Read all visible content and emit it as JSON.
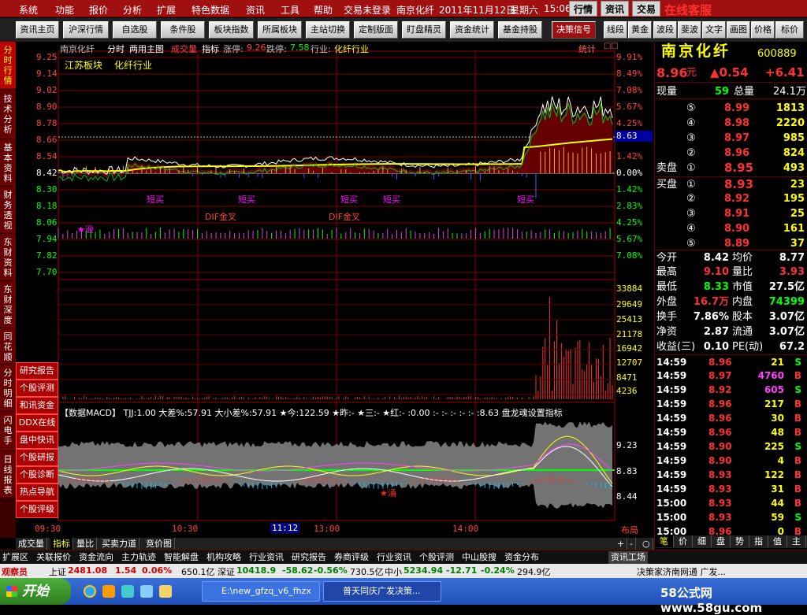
{
  "menu": {
    "items": [
      "系统",
      "功能",
      "报价",
      "分析",
      "扩展",
      "特色数据",
      "资讯",
      "工具",
      "帮助",
      "交易未登录",
      "南京化纤",
      "2011年11月12日",
      "星期六",
      "15:06"
    ],
    "tabs": [
      "行情",
      "资讯",
      "交易"
    ],
    "brand": "在线客服 www.55188.com"
  },
  "toolbar": {
    "buttons": [
      "资讯主页",
      "沪深行情",
      "自选股",
      "条件股",
      "板块指数",
      "所属板块",
      "主站切换",
      "定制版面",
      "盯盘精灵",
      "资金统计",
      "基金持股",
      "决策信号",
      "线段",
      "黄金",
      "波段",
      "斐波",
      "文字",
      "画图",
      "价格",
      "标价"
    ]
  },
  "left_nav": [
    "分时行情",
    "技术分析",
    "基本资料",
    "财务透视",
    "东财资料",
    "东财深度",
    "同花顺",
    "分时明细",
    "闪电手",
    "日线报表"
  ],
  "left_links": [
    "研究报告",
    "个股评测",
    "和讯资金",
    "DDX在线",
    "盘中快讯",
    "个股研报",
    "个股诊断",
    "热点导航",
    "个股评级"
  ],
  "chart": {
    "header": {
      "name": "南京化纤",
      "mode": "分时",
      "main": "两用主图",
      "vol": "成交量",
      "ind": "指标",
      "up_label": "涨停:",
      "up_val": "9.26",
      "down_label": "跌停:",
      "down_val": "7.58",
      "ind_label": "行业:",
      "ind_val": "化纤行业",
      "stat": "统计"
    },
    "board": [
      "江苏板块",
      "化纤行业"
    ],
    "price_labels": [
      "9.25",
      "9.14",
      "9.02",
      "8.90",
      "8.78",
      "8.66",
      "8.54",
      "8.42",
      "8.30",
      "8.18",
      "8.06",
      "7.94",
      "7.82",
      "7.70"
    ],
    "pct_labels": [
      "9.91%",
      "8.49%",
      "7.08%",
      "5.67%",
      "4.25%",
      "2.83%",
      "1.42%",
      "0.00%",
      "1.42%",
      "2.83%",
      "4.25%",
      "5.67%",
      "7.08%"
    ],
    "current_tag": "8.63",
    "vol_labels": [
      "33884",
      "29649",
      "25413",
      "21178",
      "16942",
      "12707",
      "8471",
      "4236"
    ],
    "signals": [
      "短买",
      "短买",
      "短买",
      "短买",
      "短买"
    ],
    "dif_cross": [
      "DIF金叉",
      "DIF金叉"
    ],
    "star_label": "★逊",
    "macd_header": "【数据MACD】 TJJ:1.00 大差%:57.91 大小差%:57.91 ★今:122.59 ★昨:- ★三:- ★红:- :0.00 :- :- :- :- :- :8.63 盘龙魂设置指标",
    "macd_labels": [
      "9.23",
      "8.83",
      "8.44"
    ],
    "macd_star": "★涌",
    "time_labels": [
      "09:30",
      "10:30",
      "11:12",
      "13:00",
      "14:00"
    ],
    "layout_btn": "布局"
  },
  "quote": {
    "name": "南京化纤",
    "code": "600889",
    "price": "8.96",
    "price_unit": "元",
    "change": "▲0.54",
    "change_pct": "+6.41",
    "cur_vol_label": "现量",
    "cur_vol": "59",
    "total_vol_label": "总量",
    "total_vol": "24.1万",
    "asks": [
      {
        "lv": "⑤",
        "p": "8.99",
        "v": "1813"
      },
      {
        "lv": "④",
        "p": "8.98",
        "v": "2220"
      },
      {
        "lv": "③",
        "p": "8.97",
        "v": "985"
      },
      {
        "lv": "②",
        "p": "8.96",
        "v": "824"
      },
      {
        "lv": "①",
        "p": "8.95",
        "v": "493",
        "label": "卖盘"
      }
    ],
    "bids": [
      {
        "lv": "①",
        "p": "8.93",
        "v": "23",
        "label": "买盘"
      },
      {
        "lv": "②",
        "p": "8.92",
        "v": "195"
      },
      {
        "lv": "③",
        "p": "8.91",
        "v": "25"
      },
      {
        "lv": "④",
        "p": "8.90",
        "v": "161"
      },
      {
        "lv": "⑤",
        "p": "8.89",
        "v": "37"
      }
    ],
    "stats": [
      {
        "k1": "今开",
        "v1": "8.42",
        "k2": "均价",
        "v2": "8.77"
      },
      {
        "k1": "最高",
        "v1": "9.10",
        "k2": "量比",
        "v2": "3.93"
      },
      {
        "k1": "最低",
        "v1": "8.33",
        "k2": "市值",
        "v2": "27.5亿"
      },
      {
        "k1": "外盘",
        "v1": "16.7万",
        "k2": "内盘",
        "v2": "74399"
      },
      {
        "k1": "换手",
        "v1": "7.86%",
        "k2": "股本",
        "v2": "3.07亿"
      },
      {
        "k1": "净资",
        "v1": "2.87",
        "k2": "流通",
        "v2": "3.07亿"
      },
      {
        "k1": "收益(三)",
        "v1": "0.10",
        "k2": "PE(动)",
        "v2": "67.2"
      }
    ],
    "ticks": [
      {
        "t": "14:59",
        "p": "8.96",
        "v": "21",
        "d": "S"
      },
      {
        "t": "14:59",
        "p": "8.97",
        "v": "4760",
        "d": "B"
      },
      {
        "t": "14:59",
        "p": "8.92",
        "v": "605",
        "d": "S"
      },
      {
        "t": "14:59",
        "p": "8.96",
        "v": "217",
        "d": "B"
      },
      {
        "t": "14:59",
        "p": "8.96",
        "v": "30",
        "d": "B"
      },
      {
        "t": "14:59",
        "p": "8.96",
        "v": "48",
        "d": "B"
      },
      {
        "t": "14:59",
        "p": "8.90",
        "v": "225",
        "d": "S"
      },
      {
        "t": "14:59",
        "p": "8.90",
        "v": "4",
        "d": "B"
      },
      {
        "t": "14:59",
        "p": "8.93",
        "v": "122",
        "d": "B"
      },
      {
        "t": "14:59",
        "p": "8.93",
        "v": "31",
        "d": "B"
      },
      {
        "t": "15:00",
        "p": "8.93",
        "v": "44",
        "d": "B"
      },
      {
        "t": "15:00",
        "p": "8.93",
        "v": "59",
        "d": "S"
      },
      {
        "t": "15:00",
        "p": "8.96",
        "v": "0",
        "d": "B"
      }
    ],
    "bottom_tabs": [
      "笔",
      "价",
      "细",
      "盘",
      "势",
      "指",
      "值",
      "主"
    ]
  },
  "bottom_tabs": [
    "成交量",
    "指标",
    "量比",
    "买卖力道",
    "竞价图"
  ],
  "bottom_ctrl": [
    "+",
    "-",
    "○"
  ],
  "statusbar": [
    "扩展区",
    "关联报价",
    "资金流向",
    "主力轨迹",
    "智能解盘",
    "机构攻略",
    "行业资讯",
    "研究报告",
    "券商评级",
    "行业资讯",
    "个股评测",
    "中山股搜",
    "资金分布",
    "资讯工场"
  ],
  "indexbar": {
    "title": "观察员",
    "items": [
      {
        "name": "上证",
        "val": "2481.08",
        "chg": "1.54",
        "pct": "0.06%",
        "amt": "650.1亿"
      },
      {
        "name": "深证",
        "val": "10418.9",
        "chg": "-58.62",
        "pct": "-0.56%",
        "amt": "730.5亿"
      },
      {
        "name": "中小",
        "val": "5234.94",
        "chg": "-12.71",
        "pct": "-0.24%",
        "amt": "294.9亿"
      }
    ],
    "news": "决策家济南网通 广发..."
  },
  "taskbar": {
    "start": "开始",
    "tasks": [
      "E:\\new_gfzq_v6_fhzx",
      "普天同庆广发决策..."
    ],
    "watermark": "58公式网 www.58gu.com"
  }
}
